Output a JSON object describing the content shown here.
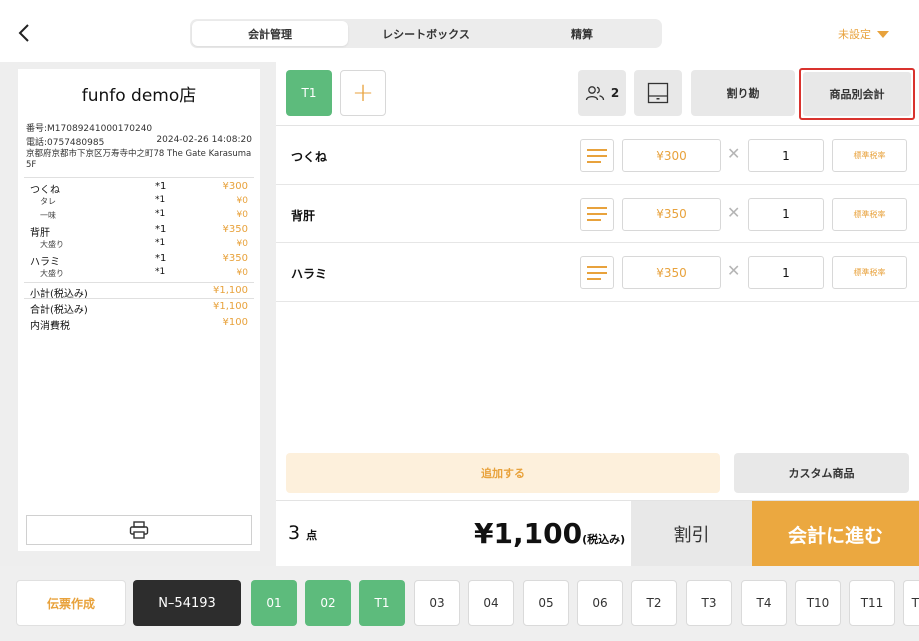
{
  "header": {
    "tabs": [
      {
        "label": "会計管理",
        "active": true
      },
      {
        "label": "レシートボックス",
        "active": false
      },
      {
        "label": "精算",
        "active": false
      }
    ],
    "store_selector": "未設定"
  },
  "receipt": {
    "shop_name": "funfo demo店",
    "number": "番号:M17089241000170240",
    "phone": "電話:0757480985",
    "datetime": "2024-02-26 14:08:20",
    "address": "京都府京都市下京区万寿寺中之町78 The Gate Karasuma 5F",
    "items": [
      {
        "name": "つくね",
        "qty": "*1",
        "price": "¥300",
        "sub": false
      },
      {
        "name": "タレ",
        "qty": "*1",
        "price": "¥0",
        "sub": true
      },
      {
        "name": "一味",
        "qty": "*1",
        "price": "¥0",
        "sub": true
      },
      {
        "name": "背肝",
        "qty": "*1",
        "price": "¥350",
        "sub": false
      },
      {
        "name": "大盛り",
        "qty": "*1",
        "price": "¥0",
        "sub": true
      },
      {
        "name": "ハラミ",
        "qty": "*1",
        "price": "¥350",
        "sub": false
      },
      {
        "name": "大盛り",
        "qty": "*1",
        "price": "¥0",
        "sub": true
      }
    ],
    "subtotal_label": "小計(税込み)",
    "subtotal_value": "¥1,100",
    "total_label": "合計(税込み)",
    "total_value": "¥1,100",
    "tax_label": "内消費税",
    "tax_value": "¥100"
  },
  "toolbar": {
    "table_label": "T1",
    "add_label": "+",
    "guests": "2",
    "split_label": "割り勘",
    "per_product_label": "商品別会計"
  },
  "order_rows": [
    {
      "name": "つくね",
      "price": "¥300",
      "qty": "1",
      "tax": "標準税率"
    },
    {
      "name": "背肝",
      "price": "¥350",
      "qty": "1",
      "tax": "標準税率"
    },
    {
      "name": "ハラミ",
      "price": "¥350",
      "qty": "1",
      "tax": "標準税率"
    }
  ],
  "actions": {
    "add_label": "追加する",
    "custom_label": "カスタム商品"
  },
  "totals": {
    "count": "3",
    "count_unit": "点",
    "amount": "¥1,100",
    "amount_suffix": "(税込み)",
    "discount_label": "割引",
    "pay_label": "会計に進む"
  },
  "footer": {
    "voucher_label": "伝票作成",
    "order_number": "N–54193",
    "tables": [
      {
        "label": "01",
        "active": true
      },
      {
        "label": "02",
        "active": true
      },
      {
        "label": "T1",
        "active": true
      },
      {
        "label": "03",
        "active": false
      },
      {
        "label": "04",
        "active": false
      },
      {
        "label": "05",
        "active": false
      },
      {
        "label": "06",
        "active": false
      },
      {
        "label": "T2",
        "active": false
      },
      {
        "label": "T3",
        "active": false
      },
      {
        "label": "T4",
        "active": false
      },
      {
        "label": "T10",
        "active": false
      },
      {
        "label": "T11",
        "active": false
      },
      {
        "label": "T",
        "active": false
      }
    ]
  },
  "colors": {
    "accent": "#e8a23c",
    "green": "#5dbb7c",
    "highlight_border": "#d9332e"
  }
}
